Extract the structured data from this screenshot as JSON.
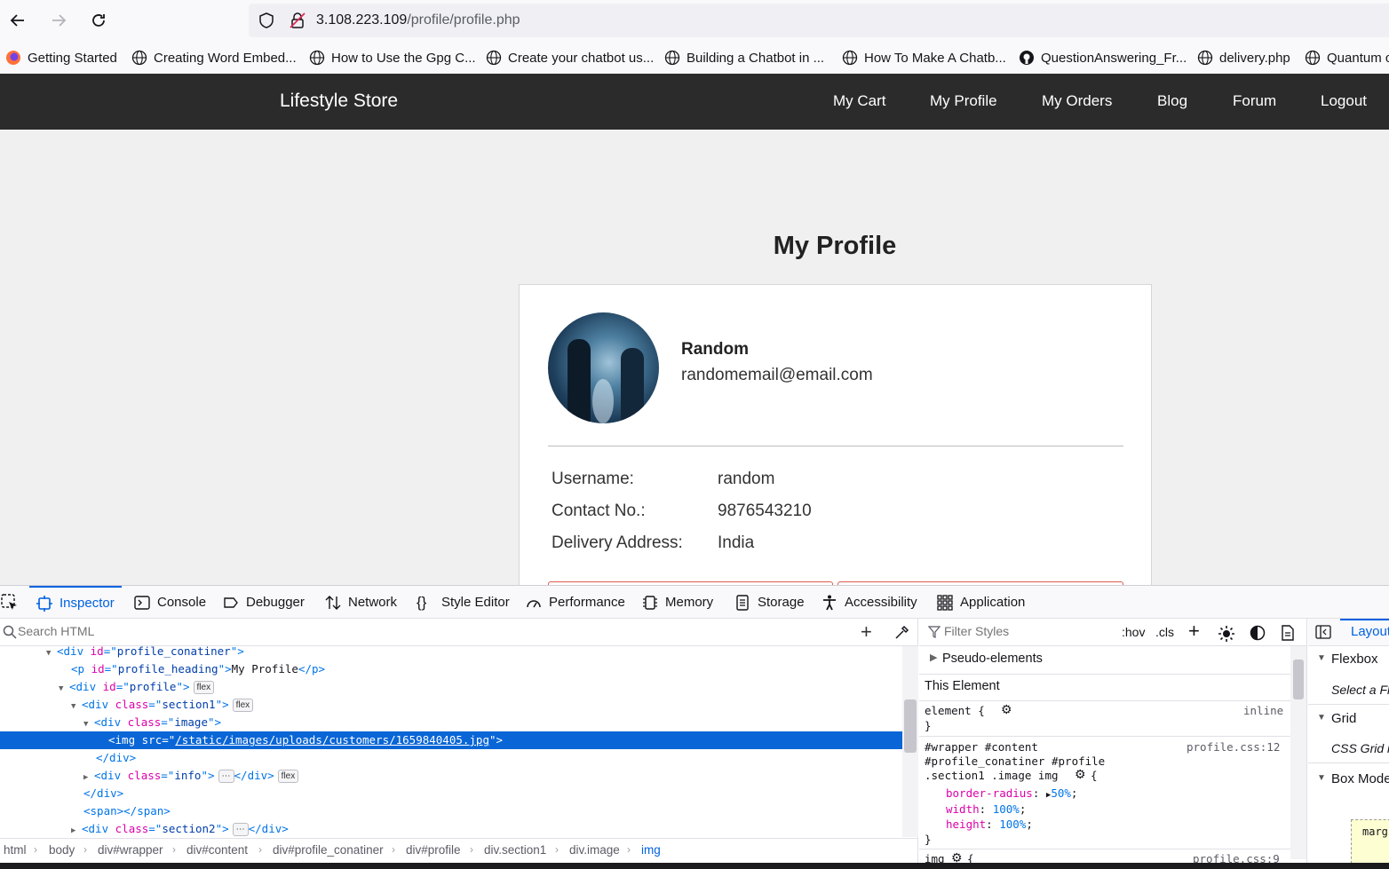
{
  "browser": {
    "url_host": "3.108.223.109",
    "url_path": "/profile/profile.php"
  },
  "bookmarks": [
    "Getting Started",
    "Creating Word Embed...",
    "How to Use the Gpg C...",
    "Create your chatbot us...",
    "Building a Chatbot in ...",
    "How To Make A Chatb...",
    "QuestionAnswering_Fr...",
    "delivery.php",
    "Quantum c"
  ],
  "site": {
    "brand": "Lifestyle Store",
    "nav": [
      "My Cart",
      "My Profile",
      "My Orders",
      "Blog",
      "Forum",
      "Logout"
    ]
  },
  "profile": {
    "heading": "My Profile",
    "name": "Random",
    "email": "randomemail@email.com",
    "fields": [
      {
        "label": "Username:",
        "value": "random"
      },
      {
        "label": "Contact No.:",
        "value": "9876543210"
      },
      {
        "label": "Delivery Address:",
        "value": "India"
      }
    ]
  },
  "devtools": {
    "tabs": [
      "Inspector",
      "Console",
      "Debugger",
      "Network",
      "Style Editor",
      "Performance",
      "Memory",
      "Storage",
      "Accessibility",
      "Application"
    ],
    "search_placeholder": "Search HTML",
    "filter_placeholder": "Filter Styles",
    "hov": ":hov",
    "cls": ".cls",
    "markup": {
      "l1_id": "profile_conatiner",
      "l2_id": "profile_heading",
      "l2_text": "My Profile",
      "l3_id": "profile",
      "l4_class": "section1",
      "l5_class": "image",
      "img_src": "/static/images/uploads/customers/1659840405.jpg",
      "l8_class": "info",
      "l11_class": "section2",
      "flex_badge": "flex"
    },
    "breadcrumbs": [
      "html",
      "body",
      "div#wrapper",
      "div#content",
      "div#profile_conatiner",
      "div#profile",
      "div.section1",
      "div.image",
      "img"
    ],
    "rules": {
      "pseudo": "Pseudo-elements",
      "this_element": "This Element",
      "element_sel": "element {",
      "inline": "inline",
      "close": "}",
      "sel1": "#wrapper #content",
      "sel2": "#profile_conatiner #profile",
      "sel3": ".section1 .image img",
      "src1": "profile.css:12",
      "p1": "border-radius",
      "v1": "50%",
      "p2": "width",
      "v2": "100%",
      "p3": "height",
      "v3": "100%",
      "img_sel": "img",
      "src2": "profile.css:9"
    },
    "layout": {
      "tab": "Layout",
      "flexbox": "Flexbox",
      "flex_hint": "Select a Fl",
      "grid": "Grid",
      "grid_hint": "CSS Grid is",
      "box_model": "Box Mode",
      "margin": "marg"
    }
  }
}
